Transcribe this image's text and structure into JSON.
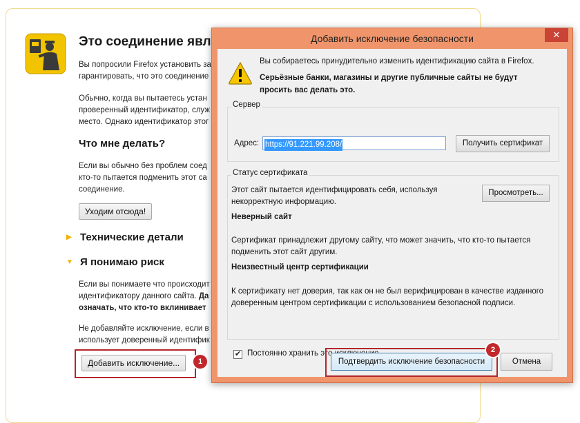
{
  "page": {
    "title": "Это соединение явля",
    "p1": [
      "Вы попросили Firefox установить за",
      "гарантировать, что это соединение"
    ],
    "p2": [
      "Обычно, когда вы пытаетесь устан",
      "проверенный идентификатор, служ",
      "место. Однако идентификатор этог"
    ],
    "what_heading": "Что мне делать?",
    "p3": [
      "Если вы обычно без проблем соед",
      "кто-то пытается подменить этот са",
      "соединение."
    ],
    "leave_button": "Уходим отсюда!",
    "tech_details": "Технические детали",
    "understand_risk": "Я понимаю риск",
    "p4_line1": "Если вы понимаете что происходит",
    "p4_line2a": "идентификатору данного сайта. ",
    "p4_line2b": "Да",
    "p4_line3": "означать, что кто-то вклинивает",
    "p5": [
      "Не добавляйте исключение, если в",
      "использует доверенный идентифик"
    ],
    "add_exception_button": "Добавить исключение...",
    "badge1": "1"
  },
  "dialog": {
    "title": "Добавить исключение безопасности",
    "close_glyph": "✕",
    "intro": "Вы собираетесь принудительно изменить идентификацию сайта в Firefox.",
    "warning_bold": "Серьёзные банки, магазины и другие публичные сайты не будут просить вас делать это.",
    "server_legend": "Сервер",
    "address_label": "Адрес:",
    "address_value": "https://91.221.99.208/",
    "get_cert_button": "Получить сертификат",
    "status_legend": "Статус сертификата",
    "status_text1": "Этот сайт пытается идентифицировать себя, используя",
    "status_text2": "некорректную информацию.",
    "view_button": "Просмотреть...",
    "wrong_site_heading": "Неверный сайт",
    "wrong_site_text": "Сертификат принадлежит другому сайту, что может значить, что кто-то пытается подменить этот сайт другим.",
    "unknown_ca_heading": "Неизвестный центр сертификации",
    "unknown_ca_text": "К сертификату нет доверия, так как он не был верифицирован в качестве изданного доверенным центром сертификации с использованием безопасной подписи.",
    "permanent_label": "Постоянно хранить это исключение",
    "permanent_checked": "✔",
    "confirm_button": "Подтвердить исключение безопасности",
    "cancel_button": "Отмена",
    "badge2": "2"
  },
  "colors": {
    "dialog_border": "#f0956b",
    "close_bg": "#c94336",
    "badge": "#c3272b",
    "frame": "#b3262b"
  },
  "icons": [
    "security-officer-icon",
    "warning-icon",
    "close-icon",
    "triangle-right-icon",
    "triangle-down-icon",
    "checkbox-icon"
  ]
}
